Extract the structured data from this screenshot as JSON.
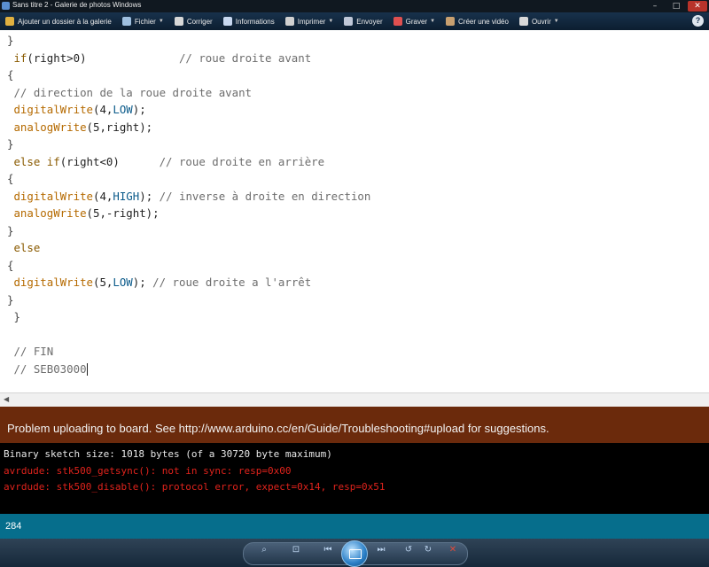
{
  "window": {
    "title": "Sans titre 2 - Galerie de photos Windows",
    "buttons": [
      "–",
      "□",
      "✕"
    ]
  },
  "toolbar": {
    "items": [
      {
        "label": "Ajouter un dossier à la galerie",
        "icon": "folder-add-icon",
        "color": "#e0b040",
        "dropdown": false
      },
      {
        "label": "Fichier",
        "icon": "file-icon",
        "color": "#9fc0e0",
        "dropdown": true
      },
      {
        "label": "Corriger",
        "icon": "fix-icon",
        "color": "#d8d8d8",
        "dropdown": false
      },
      {
        "label": "Informations",
        "icon": "info-icon",
        "color": "#c8d8f0",
        "dropdown": false
      },
      {
        "label": "Imprimer",
        "icon": "printer-icon",
        "color": "#d0d0d0",
        "dropdown": true
      },
      {
        "label": "Envoyer",
        "icon": "email-icon",
        "color": "#c0c8d8",
        "dropdown": false
      },
      {
        "label": "Graver",
        "icon": "burn-disc-icon",
        "color": "#e05050",
        "dropdown": true
      },
      {
        "label": "Créer une vidéo",
        "icon": "movie-icon",
        "color": "#c8a070",
        "dropdown": false
      },
      {
        "label": "Ouvrir",
        "icon": "open-icon",
        "color": "#d8d8d8",
        "dropdown": true
      }
    ],
    "help_label": "?"
  },
  "editor": {
    "lines": [
      [
        {
          "t": "}",
          "c": "br"
        }
      ],
      [
        {
          "t": " "
        },
        {
          "t": "if",
          "c": "kw"
        },
        {
          "t": "(right>0)              "
        },
        {
          "t": "// roue droite avant",
          "c": "cm"
        }
      ],
      [
        {
          "t": "{",
          "c": "br"
        }
      ],
      [
        {
          "t": " "
        },
        {
          "t": "// direction de la roue droite avant",
          "c": "cm"
        }
      ],
      [
        {
          "t": " "
        },
        {
          "t": "digitalWrite",
          "c": "fn"
        },
        {
          "t": "(4,"
        },
        {
          "t": "LOW",
          "c": "cn"
        },
        {
          "t": ");"
        }
      ],
      [
        {
          "t": " "
        },
        {
          "t": "analogWrite",
          "c": "fn"
        },
        {
          "t": "(5,right);"
        }
      ],
      [
        {
          "t": "}",
          "c": "br"
        }
      ],
      [
        {
          "t": " "
        },
        {
          "t": "else if",
          "c": "kw"
        },
        {
          "t": "(right<0)      "
        },
        {
          "t": "// roue droite en arrière",
          "c": "cm"
        }
      ],
      [
        {
          "t": "{",
          "c": "br"
        }
      ],
      [
        {
          "t": " "
        },
        {
          "t": "digitalWrite",
          "c": "fn"
        },
        {
          "t": "(4,"
        },
        {
          "t": "HIGH",
          "c": "cn"
        },
        {
          "t": "); "
        },
        {
          "t": "// inverse à droite en direction",
          "c": "cm"
        }
      ],
      [
        {
          "t": " "
        },
        {
          "t": "analogWrite",
          "c": "fn"
        },
        {
          "t": "(5,-right);"
        }
      ],
      [
        {
          "t": "}",
          "c": "br"
        }
      ],
      [
        {
          "t": " "
        },
        {
          "t": "else",
          "c": "kw"
        }
      ],
      [
        {
          "t": "{",
          "c": "br"
        }
      ],
      [
        {
          "t": " "
        },
        {
          "t": "digitalWrite",
          "c": "fn"
        },
        {
          "t": "(5,"
        },
        {
          "t": "LOW",
          "c": "cn"
        },
        {
          "t": "); "
        },
        {
          "t": "// roue droite a l'arrêt",
          "c": "cm"
        }
      ],
      [
        {
          "t": "}",
          "c": "br"
        }
      ],
      [
        {
          "t": " }",
          "c": "br"
        }
      ],
      [
        {
          "t": ""
        }
      ],
      [
        {
          "t": " "
        },
        {
          "t": "// FIN",
          "c": "cm"
        }
      ],
      [
        {
          "t": " "
        },
        {
          "t": "// SEB03000",
          "c": "cm"
        },
        {
          "caret": true
        }
      ]
    ]
  },
  "scrollbar": {
    "left_arrow": "◀"
  },
  "message": {
    "text": "Problem uploading to board.  See http://www.arduino.cc/en/Guide/Troubleshooting#upload for suggestions."
  },
  "console": {
    "lines": [
      {
        "text": "Binary sketch size: 1018 bytes (of a 30720 byte maximum)",
        "color": "white"
      },
      {
        "text": "avrdude: stk500_getsync(): not in sync: resp=0x00",
        "color": "red"
      },
      {
        "text": "avrdude: stk500_disable(): protocol error, expect=0x14, resp=0x51",
        "color": "red"
      }
    ]
  },
  "status": {
    "line_number": "284"
  },
  "navbar": {
    "buttons": [
      {
        "name": "zoom-icon",
        "glyph": "⌕"
      },
      {
        "name": "actual-size-icon",
        "glyph": "⊡"
      },
      {
        "name": "previous-icon",
        "glyph": "⏮"
      },
      {
        "name": "next-icon",
        "glyph": "⏭"
      },
      {
        "name": "rotate-left-icon",
        "glyph": "↺"
      },
      {
        "name": "rotate-right-icon",
        "glyph": "↻"
      },
      {
        "name": "delete-icon",
        "glyph": "✕"
      }
    ]
  }
}
